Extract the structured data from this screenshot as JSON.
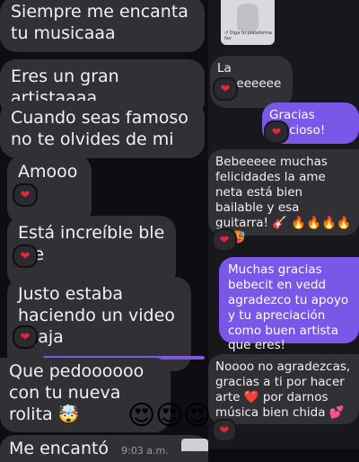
{
  "preview": {
    "caption": "↺ Diga tu plataforma fav"
  },
  "messages": {
    "m1": "Siempre me encanta tu musicaaa",
    "m2": "Eres un gran artistaaaa",
    "m3": "Cuando seas famoso no te olvides de mi",
    "m4": "Amoooo",
    "m5": "Está increíble ble ble",
    "m6": "Justo estaba haciendo un video jajaja",
    "m7": "Que pedoooooo con tu nueva rolita 🤯",
    "m8": "Me encantó",
    "m8_time": "9:03 a.m.",
    "r1": "La ameeeeee",
    "r2": "Gracias precioso!",
    "r3": "Bebeeeee muchas felicidades la ame neta está bien bailable y esa guitarra! 🎸 🔥🔥🔥🔥🔥🥵",
    "r4": "Muchas gracias bebecit en vedd agradezco tu apoyo y tu apreciación como buen artista que eres!",
    "r5": "Noooo no agradezcas, gracias a ti por hacer arte ❤️ por darnos música bien chida 💕 🔥"
  },
  "reaction": {
    "heart": "❤"
  },
  "emojis": {
    "heart_eyes": "😍"
  },
  "colors": {
    "incoming": "#303035",
    "outgoing": "#7a57e6",
    "background": "#0d0d12"
  }
}
